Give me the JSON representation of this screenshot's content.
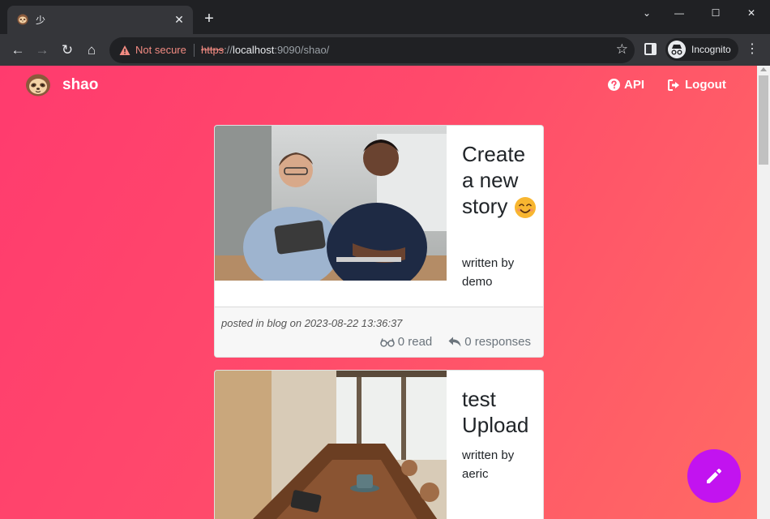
{
  "browser": {
    "tab_title": "少",
    "not_secure": "Not secure",
    "url_scheme": "https",
    "url_sep": "://",
    "url_host": "localhost",
    "url_rest": ":9090/shao/",
    "incognito": "Incognito"
  },
  "navbar": {
    "brand": "shao",
    "api_label": "API",
    "logout_label": "Logout"
  },
  "posts": [
    {
      "title": "Create a new story",
      "written_by": "written by",
      "author": "demo",
      "posted_prefix": "posted in",
      "category": "blog",
      "on_label": "on",
      "date": "2023-08-22 13:36:37",
      "reads": "0 read",
      "responses": "0 responses"
    },
    {
      "title": "test Upload",
      "written_by": "written by",
      "author": "aeric"
    }
  ],
  "colors": {
    "accent_fab": "#c213f0",
    "bg_start": "#ff3b6e",
    "bg_end": "#ff6a64"
  },
  "icons": {
    "read": "glasses-icon",
    "responses": "reply-icon",
    "fab": "pencil-icon"
  }
}
